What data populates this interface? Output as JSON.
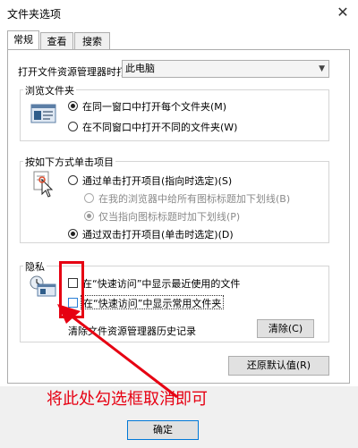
{
  "window": {
    "title": "文件夹选项"
  },
  "tabs": [
    {
      "label": "常规",
      "active": true
    },
    {
      "label": "查看",
      "active": false
    },
    {
      "label": "搜索",
      "active": false
    }
  ],
  "open_explorer": {
    "label": "打开文件资源管理器时打",
    "value": "此电脑"
  },
  "browse": {
    "title": "浏览文件夹",
    "options": [
      {
        "label": "在同一窗口中打开每个文件夹(M)",
        "checked": true
      },
      {
        "label": "在不同窗口中打开不同的文件夹(W)",
        "checked": false
      }
    ]
  },
  "click": {
    "title": "按如下方式单击项目",
    "options": [
      {
        "label": "通过单击打开项目(指向时选定)(S)",
        "checked": false,
        "disabled": false
      },
      {
        "label": "在我的浏览器中给所有图标标题加下划线(B)",
        "checked": false,
        "disabled": true
      },
      {
        "label": "仅当指向图标标题时加下划线(P)",
        "checked": true,
        "disabled": true
      },
      {
        "label": "通过双击打开项目(单击时选定)(D)",
        "checked": true,
        "disabled": false
      }
    ]
  },
  "privacy": {
    "title": "隐私",
    "options": [
      {
        "label": "在“快速访问”中显示最近使用的文件",
        "checked": false
      },
      {
        "label": "在“快速访问”中显示常用文件夹",
        "checked": false
      }
    ],
    "clear_label": "清除文件资源管理器历史记录",
    "clear_button": "清除(C)"
  },
  "restore_button": "还原默认值(R)",
  "annotation": "将此处勾选框取消即可",
  "ok_button": "确定",
  "colors": {
    "annotation": "#e60012",
    "accent": "#0078d7"
  }
}
